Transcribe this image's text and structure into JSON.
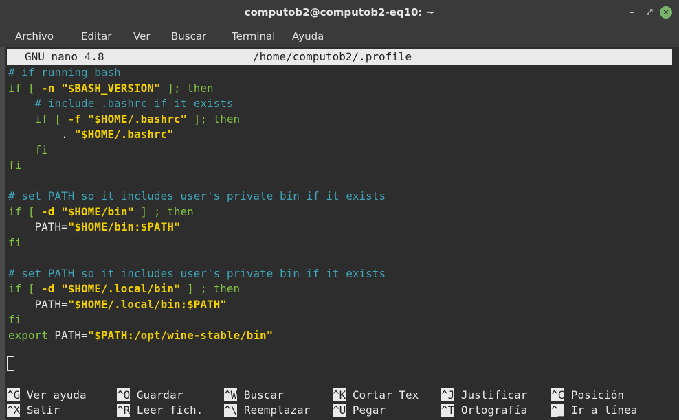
{
  "window": {
    "title": "computob2@computob2-eq10: ~",
    "controls": {
      "minimize": "–",
      "maximize": "⤢",
      "close": "✕"
    }
  },
  "menu": [
    "Archivo",
    "Editar",
    "Ver",
    "Buscar",
    "Terminal",
    "Ayuda"
  ],
  "nano": {
    "version": "GNU nano 4.8",
    "filename": "/home/computob2/.profile"
  },
  "code_lines": [
    [
      [
        "cm",
        "# if running bash"
      ]
    ],
    [
      [
        "kw",
        "if [ "
      ],
      [
        "ye",
        "-n \"$BASH_VERSION\""
      ],
      [
        "kw",
        " ]; then"
      ]
    ],
    [
      [
        "kw",
        "    "
      ],
      [
        "cm",
        "# include .bashrc if it exists"
      ]
    ],
    [
      [
        "kw",
        "    if [ "
      ],
      [
        "ye",
        "-f \"$HOME/.bashrc\""
      ],
      [
        "kw",
        " ]; then"
      ]
    ],
    [
      [
        "wh",
        "        . "
      ],
      [
        "ye",
        "\"$HOME/.bashrc\""
      ]
    ],
    [
      [
        "kw",
        "    fi"
      ]
    ],
    [
      [
        "kw",
        "fi"
      ]
    ],
    [
      [
        "wh",
        ""
      ]
    ],
    [
      [
        "cm",
        "# set PATH so it includes user's private bin if it exists"
      ]
    ],
    [
      [
        "kw",
        "if [ "
      ],
      [
        "ye",
        "-d \"$HOME/bin\""
      ],
      [
        "kw",
        " ] ; then"
      ]
    ],
    [
      [
        "wh",
        "    PATH="
      ],
      [
        "ye",
        "\"$HOME/bin:$PATH\""
      ]
    ],
    [
      [
        "kw",
        "fi"
      ]
    ],
    [
      [
        "wh",
        ""
      ]
    ],
    [
      [
        "cm",
        "# set PATH so it includes user's private bin if it exists"
      ]
    ],
    [
      [
        "kw",
        "if [ "
      ],
      [
        "ye",
        "-d \"$HOME/.local/bin\""
      ],
      [
        "kw",
        " ] ; then"
      ]
    ],
    [
      [
        "wh",
        "    PATH="
      ],
      [
        "ye",
        "\"$HOME/.local/bin:$PATH\""
      ]
    ],
    [
      [
        "kw",
        "fi"
      ]
    ],
    [
      [
        "kw",
        "export"
      ],
      [
        "wh",
        " PATH="
      ],
      [
        "ye",
        "\"$PATH:/opt/wine-stable/bin\""
      ]
    ]
  ],
  "shortcuts_row1": [
    {
      "key": "^G",
      "label": "Ver ayuda"
    },
    {
      "key": "^O",
      "label": "Guardar"
    },
    {
      "key": "^W",
      "label": "Buscar"
    },
    {
      "key": "^K",
      "label": "Cortar Tex"
    },
    {
      "key": "^J",
      "label": "Justificar"
    },
    {
      "key": "^C",
      "label": "Posición"
    }
  ],
  "shortcuts_row2": [
    {
      "key": "^X",
      "label": "Salir"
    },
    {
      "key": "^R",
      "label": "Leer fich."
    },
    {
      "key": "^\\",
      "label": "Reemplazar"
    },
    {
      "key": "^U",
      "label": "Pegar"
    },
    {
      "key": "^T",
      "label": "Ortografía"
    },
    {
      "key": "^_",
      "label": "Ir a línea"
    }
  ]
}
